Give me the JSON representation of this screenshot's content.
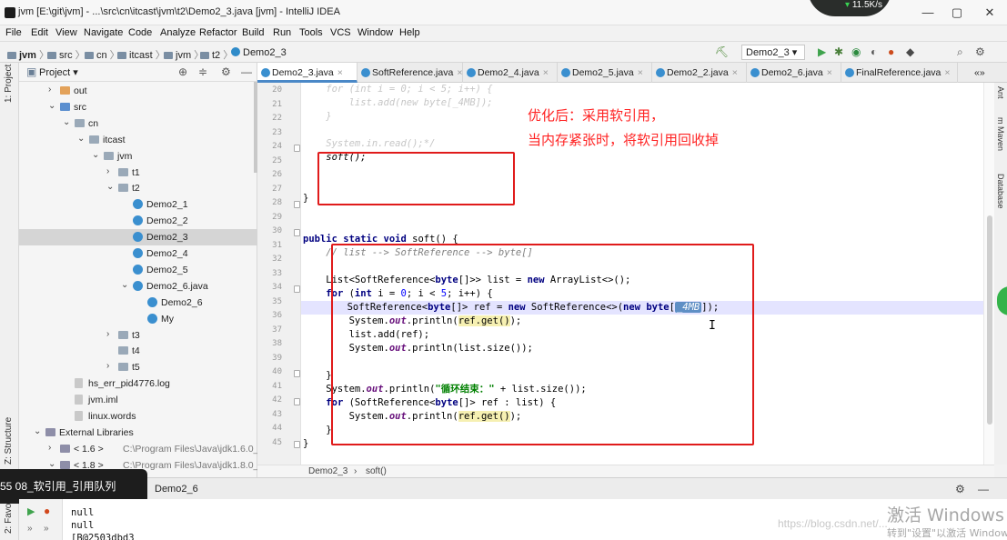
{
  "window": {
    "title": "jvm [E:\\git\\jvm] - ...\\src\\cn\\itcast\\jvm\\t2\\Demo2_3.java [jvm] - IntelliJ IDEA",
    "speed": "11.5K/s",
    "minimize": "—",
    "maximize": "▢",
    "close": "✕"
  },
  "menu": [
    "File",
    "Edit",
    "View",
    "Navigate",
    "Code",
    "Analyze",
    "Refactor",
    "Build",
    "Run",
    "Tools",
    "VCS",
    "Window",
    "Help"
  ],
  "breadcrumb": [
    "jvm",
    "src",
    "cn",
    "itcast",
    "jvm",
    "t2",
    "Demo2_3"
  ],
  "run_config": "Demo2_3",
  "project_panel": {
    "label": "Project",
    "tree": [
      {
        "label": "out",
        "depth": 1,
        "arrow": "›",
        "icon": "orange"
      },
      {
        "label": "src",
        "depth": 1,
        "arrow": "⌄",
        "icon": "blue"
      },
      {
        "label": "cn",
        "depth": 2,
        "arrow": "⌄",
        "icon": "folder"
      },
      {
        "label": "itcast",
        "depth": 3,
        "arrow": "⌄",
        "icon": "folder"
      },
      {
        "label": "jvm",
        "depth": 4,
        "arrow": "⌄",
        "icon": "folder"
      },
      {
        "label": "t1",
        "depth": 5,
        "arrow": "›",
        "icon": "folder"
      },
      {
        "label": "t2",
        "depth": 5,
        "arrow": "⌄",
        "icon": "folder"
      },
      {
        "label": "Demo2_1",
        "depth": 6,
        "arrow": "",
        "icon": "cls"
      },
      {
        "label": "Demo2_2",
        "depth": 6,
        "arrow": "",
        "icon": "cls"
      },
      {
        "label": "Demo2_3",
        "depth": 6,
        "arrow": "",
        "icon": "cls",
        "selected": true
      },
      {
        "label": "Demo2_4",
        "depth": 6,
        "arrow": "",
        "icon": "cls"
      },
      {
        "label": "Demo2_5",
        "depth": 6,
        "arrow": "",
        "icon": "cls"
      },
      {
        "label": "Demo2_6.java",
        "depth": 6,
        "arrow": "⌄",
        "icon": "cls"
      },
      {
        "label": "Demo2_6",
        "depth": 7,
        "arrow": "",
        "icon": "cls"
      },
      {
        "label": "My",
        "depth": 7,
        "arrow": "",
        "icon": "cls"
      },
      {
        "label": "t3",
        "depth": 5,
        "arrow": "›",
        "icon": "folder"
      },
      {
        "label": "t4",
        "depth": 5,
        "arrow": "",
        "icon": "folder"
      },
      {
        "label": "t5",
        "depth": 5,
        "arrow": "›",
        "icon": "folder"
      },
      {
        "label": "hs_err_pid4776.log",
        "depth": 2,
        "arrow": "",
        "icon": "file"
      },
      {
        "label": "jvm.iml",
        "depth": 2,
        "arrow": "",
        "icon": "file"
      },
      {
        "label": "linux.words",
        "depth": 2,
        "arrow": "",
        "icon": "file"
      },
      {
        "label": "External Libraries",
        "depth": 0,
        "arrow": "⌄",
        "icon": "lib"
      },
      {
        "label": "< 1.6 >",
        "extra": "C:\\Program Files\\Java\\jdk1.6.0_45",
        "depth": 1,
        "arrow": "›",
        "icon": "lib"
      },
      {
        "label": "< 1.8 >",
        "extra": "C:\\Program Files\\Java\\jdk1.8.0_91",
        "depth": 1,
        "arrow": "⌄",
        "icon": "lib"
      }
    ]
  },
  "tabs": [
    {
      "label": "Demo2_3.java",
      "active": true
    },
    {
      "label": "SoftReference.java"
    },
    {
      "label": "Demo2_4.java"
    },
    {
      "label": "Demo2_5.java"
    },
    {
      "label": "Demo2_2.java"
    },
    {
      "label": "Demo2_6.java"
    },
    {
      "label": "FinalReference.java"
    }
  ],
  "tab_overflow": "«»",
  "line_numbers": [
    "20",
    "21",
    "22",
    "23",
    "24",
    "25",
    "26",
    "27",
    "28",
    "29",
    "30",
    "31",
    "32",
    "33",
    "34",
    "35",
    "36",
    "37",
    "38",
    "39",
    "40",
    "41",
    "42",
    "43",
    "44",
    "45"
  ],
  "annotation": {
    "line1": "优化后：采用软引用，",
    "line2": "当内存紧张时，将软引用回收掉"
  },
  "editor_breadcrumb": [
    "Demo2_3",
    "soft()"
  ],
  "run_panel": {
    "tab": "Demo2_6",
    "video_label": "55 08_软引用_引用队列",
    "console": [
      "null",
      "null",
      "[B@2503dbd3"
    ]
  },
  "right_stripe": [
    "Ant",
    "m Maven",
    "Database"
  ],
  "left_stripe": [
    "1: Project",
    "Z: Structure",
    "2: Favorites"
  ],
  "watermark": "https://blog.csdn.net/...",
  "windows_activation": {
    "line1": "激活 Windows",
    "line2": "转到\"设置\"以激活 Windows。"
  },
  "colors": {
    "annotation": "#ff2323",
    "box": "#e01b1b",
    "keyword": "#000080",
    "string": "#008000"
  }
}
